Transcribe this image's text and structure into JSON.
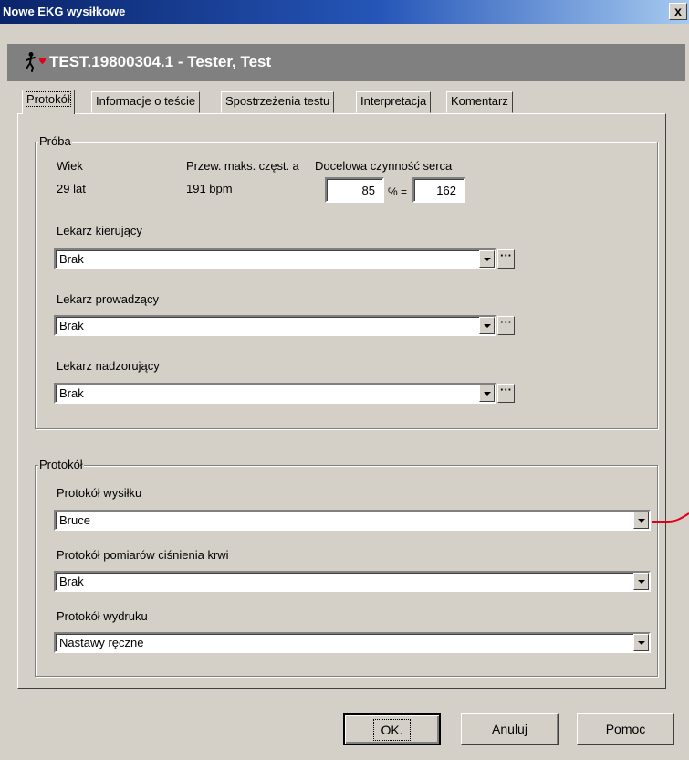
{
  "window": {
    "title": "Nowe EKG wysiłkowe",
    "close_glyph": "x"
  },
  "patient": {
    "icon": "runner-heart-icon",
    "name": "TEST.19800304.1 - Tester, Test"
  },
  "tabs": [
    {
      "label": "Protokół",
      "active": true
    },
    {
      "label": "Informacje o teście"
    },
    {
      "label": "Spostrzeżenia testu"
    },
    {
      "label": "Interpretacja"
    },
    {
      "label": "Komentarz"
    }
  ],
  "proba": {
    "legend": "Próba",
    "age_label": "Wiek",
    "age_value": "29 lat",
    "maxhr_label": "Przew. maks. częst. a",
    "maxhr_value": "191 bpm",
    "target_label": "Docelowa czynność serca",
    "percent_value": "85",
    "percent_sign": "% =",
    "target_value": "162",
    "referring": {
      "label": "Lekarz kierujący",
      "value": "Brak"
    },
    "attending": {
      "label": "Lekarz prowadzący",
      "value": "Brak"
    },
    "supervising": {
      "label": "Lekarz nadzorujący",
      "value": "Brak"
    },
    "ellipsis": "···"
  },
  "protocol": {
    "legend": "Protokół",
    "exercise": {
      "label": "Protokół wysiłku",
      "value": "Bruce"
    },
    "bp": {
      "label": "Protokół pomiarów ciśnienia krwi",
      "value": "Brak"
    },
    "print": {
      "label": "Protokół wydruku",
      "value": "Nastawy ręczne"
    }
  },
  "buttons": {
    "ok": "OK.",
    "cancel": "Anuluj",
    "help": "Pomoc"
  },
  "colors": {
    "title_bar": "#0a246a",
    "banner": "#808080",
    "face": "#d4d0c8",
    "annotation": "#e0001a"
  }
}
